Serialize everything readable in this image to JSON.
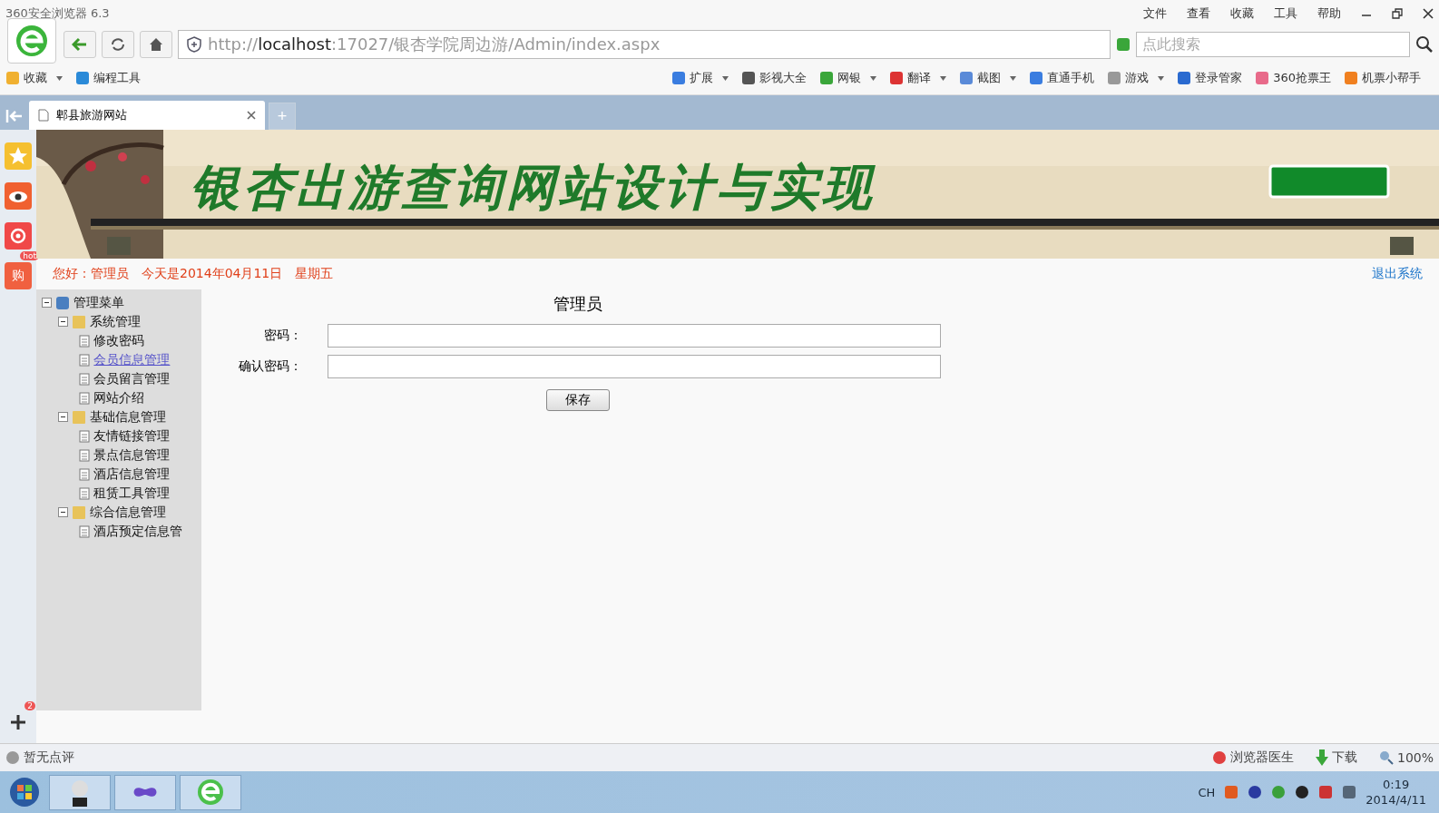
{
  "window": {
    "title": "360安全浏览器 6.3",
    "menu": [
      "文件",
      "查看",
      "收藏",
      "工具",
      "帮助"
    ]
  },
  "address_bar": {
    "scheme": "http://",
    "host": "localhost",
    "path": ":17027/银杏学院周边游/Admin/index.aspx"
  },
  "search": {
    "placeholder": "点此搜索"
  },
  "bookmarks_left": [
    {
      "label": "收藏",
      "dropdown": true
    },
    {
      "label": "编程工具",
      "dropdown": false
    }
  ],
  "bookmarks_right": [
    {
      "label": "扩展",
      "dropdown": true
    },
    {
      "label": "影视大全",
      "dropdown": false
    },
    {
      "label": "网银",
      "dropdown": true
    },
    {
      "label": "翻译",
      "dropdown": true
    },
    {
      "label": "截图",
      "dropdown": true
    },
    {
      "label": "直通手机",
      "dropdown": false
    },
    {
      "label": "游戏",
      "dropdown": true
    },
    {
      "label": "登录管家",
      "dropdown": false
    },
    {
      "label": "360抢票王",
      "dropdown": false
    },
    {
      "label": "机票小帮手",
      "dropdown": false
    }
  ],
  "tabs": [
    {
      "label": "郫县旅游网站",
      "selected": true
    }
  ],
  "new_tab": "+",
  "side_badges": {
    "hot": "hot",
    "shop": "购",
    "count": "2"
  },
  "banner": {
    "title": "银杏出游查询网站设计与实现"
  },
  "greeting": {
    "text": "您好：管理员　今天是2014年04月11日　星期五",
    "logout": "退出系统"
  },
  "tree": [
    {
      "label": "管理菜单",
      "expanded": true,
      "children": [
        {
          "label": "系统管理",
          "expanded": true,
          "children": [
            {
              "label": "修改密码",
              "hovered": false
            },
            {
              "label": "会员信息管理",
              "hovered": true
            },
            {
              "label": "会员留言管理",
              "hovered": false
            },
            {
              "label": "网站介绍",
              "hovered": false
            }
          ]
        },
        {
          "label": "基础信息管理",
          "expanded": true,
          "children": [
            {
              "label": "友情链接管理",
              "hovered": false
            },
            {
              "label": "景点信息管理",
              "hovered": false
            },
            {
              "label": "酒店信息管理",
              "hovered": false
            },
            {
              "label": "租赁工具管理",
              "hovered": false
            }
          ]
        },
        {
          "label": "综合信息管理",
          "expanded": true,
          "children": [
            {
              "label": "酒店预定信息管",
              "hovered": false
            }
          ]
        }
      ]
    }
  ],
  "form": {
    "title": "管理员",
    "fields": [
      {
        "label": "密码："
      },
      {
        "label": "确认密码："
      }
    ],
    "button": "保存"
  },
  "status_bar": {
    "left": "暂无点评",
    "doctor": "浏览器医生",
    "download": "下载",
    "zoom": "100%"
  },
  "taskbar": {
    "lang": "CH",
    "time": "0:19",
    "date": "2014/4/11"
  }
}
